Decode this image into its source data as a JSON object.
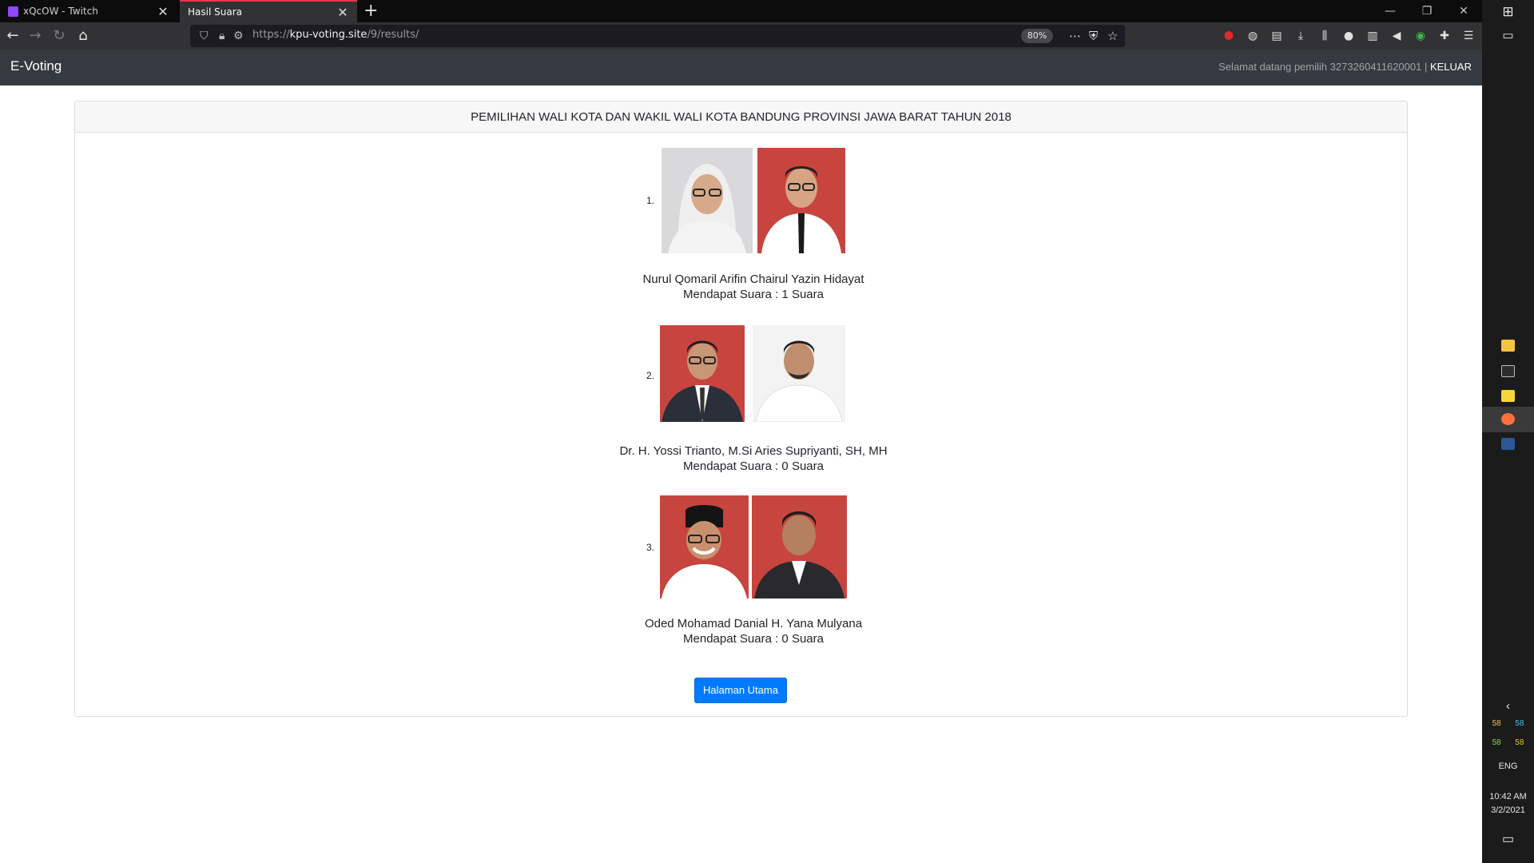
{
  "browser": {
    "tabs": [
      {
        "title": "xQcOW - Twitch",
        "active": false
      },
      {
        "title": "Hasil Suara",
        "active": true
      }
    ],
    "url": {
      "prefix": "https://",
      "host": "kpu-voting.site",
      "path": "/9/results/"
    },
    "zoom": "80%"
  },
  "site": {
    "brand": "E-Voting",
    "welcome_text": "Selamat datang pemilih 3273260411620001 |",
    "logout_label": "KELUAR"
  },
  "election": {
    "title": "PEMILIHAN WALI KOTA DAN WAKIL WALI KOTA BANDUNG PROVINSI JAWA BARAT TAHUN 2018",
    "candidates": [
      {
        "number": "1.",
        "names": "Nurul Qomaril Arifin Chairul Yazin Hidayat",
        "votes_text": "Mendapat Suara : 1 Suara",
        "votes": 1
      },
      {
        "number": "2.",
        "names": "Dr. H. Yossi Trianto, M.Si Aries Supriyanti, SH, MH",
        "votes_text": "Mendapat Suara : 0 Suara",
        "votes": 0
      },
      {
        "number": "3.",
        "names": "Oded Mohamad Danial H. Yana Mulyana",
        "votes_text": "Mendapat Suara : 0 Suara",
        "votes": 0
      }
    ],
    "home_button": "Halaman Utama"
  },
  "taskbar": {
    "tray_numbers": [
      "58",
      "58",
      "58",
      "58"
    ],
    "language": "ENG",
    "time": "10:42 AM",
    "date": "3/2/2021"
  },
  "colors": {
    "accent_tab": "#e8374d",
    "primary_button": "#007bff",
    "photo_red_bg": "#c8443f",
    "photo_gray_bg": "#d9d9db"
  }
}
